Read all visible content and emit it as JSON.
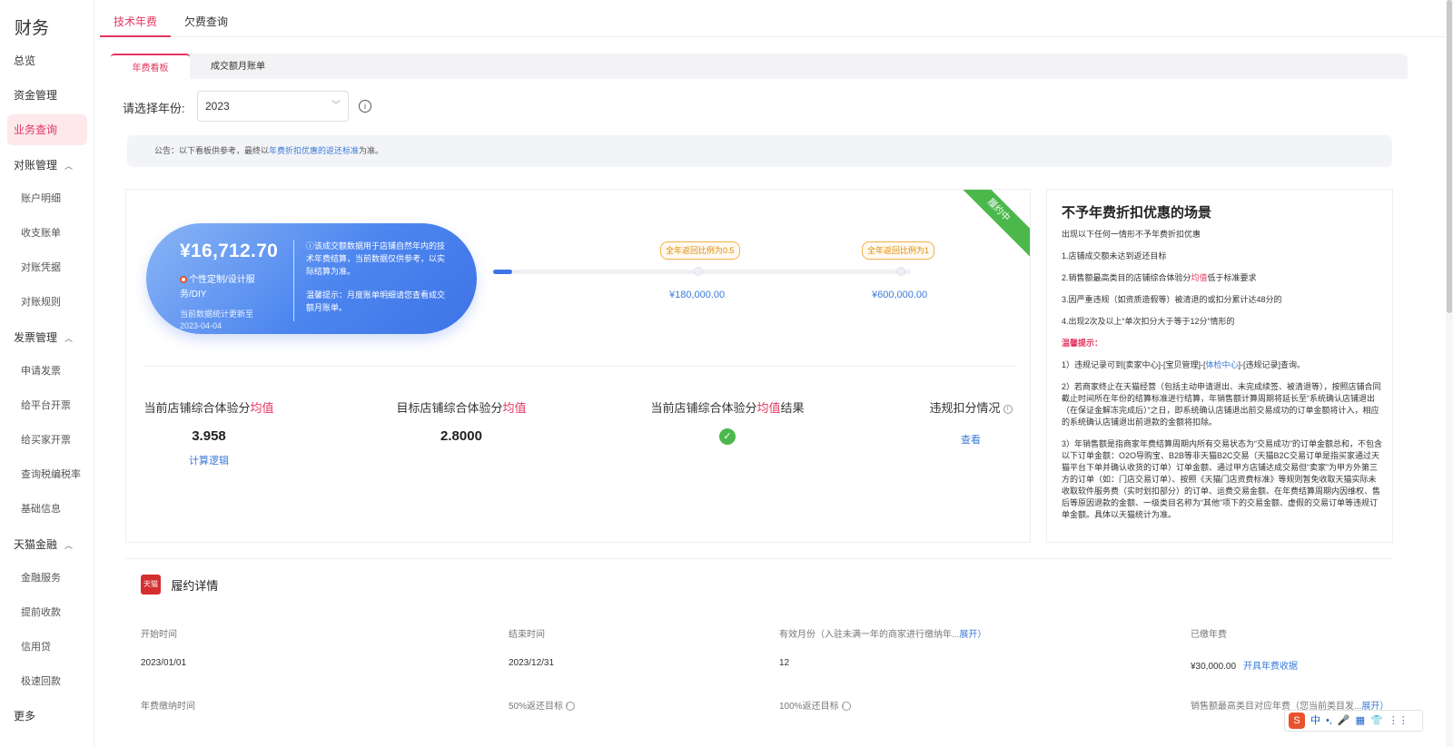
{
  "sidebar": {
    "brand": "财务",
    "items": [
      {
        "label": "总览"
      },
      {
        "label": "资金管理"
      },
      {
        "label": "业务查询"
      },
      {
        "label": "对账管理"
      },
      {
        "label": "账户明细"
      },
      {
        "label": "收支账单"
      },
      {
        "label": "对账凭据"
      },
      {
        "label": "对账规则"
      },
      {
        "label": "发票管理"
      },
      {
        "label": "申请发票"
      },
      {
        "label": "给平台开票"
      },
      {
        "label": "给买家开票"
      },
      {
        "label": "查询税编税率"
      },
      {
        "label": "基础信息"
      },
      {
        "label": "天猫金融"
      },
      {
        "label": "金融服务"
      },
      {
        "label": "提前收款"
      },
      {
        "label": "信用贷"
      },
      {
        "label": "极速回款"
      },
      {
        "label": "更多"
      }
    ]
  },
  "top_tabs": [
    {
      "label": "技术年费"
    },
    {
      "label": "欠费查询"
    }
  ],
  "inner_tabs": [
    {
      "label": "年费看板"
    },
    {
      "label": "成交额月账单"
    }
  ],
  "year": {
    "label": "请选择年份:",
    "value": "2023"
  },
  "notice": {
    "prefix": "公告：以下看板供参考，最终以",
    "link": "年费折扣优惠的返还标准",
    "suffix": "为准。"
  },
  "card": {
    "ribbon": "履约中",
    "amount": "¥16,712.70",
    "service": "个性定制/设计服务/DIY",
    "update": "当前数据统计更新至2023-04-04",
    "desc": "ⓘ该成交额数据用于店铺自然年内的技术年费结算，当前数据仅供参考，以实际结算为准。",
    "tip": "温馨提示：月度账单明细请您查看成交额月账单。",
    "milestones": [
      {
        "label": "全年返回比例为0.5",
        "amount": "¥180,000.00"
      },
      {
        "label": "全年返回比例为1",
        "amount": "¥600,000.00"
      }
    ],
    "progress": 0.045,
    "metrics": [
      {
        "label_prefix": "当前店铺综合体验分",
        "label_hl": "均值",
        "label_suffix": "",
        "value": "3.958",
        "link": "计算逻辑"
      },
      {
        "label_prefix": "目标店铺综合体验分",
        "label_hl": "均值",
        "label_suffix": "",
        "value": "2.8000"
      },
      {
        "label_prefix": "当前店铺综合体验分",
        "label_hl": "均值",
        "label_suffix": "结果",
        "value": "✓"
      },
      {
        "label_prefix": "违规扣分情况",
        "label_hl": "",
        "label_suffix": "",
        "link": "查看"
      }
    ]
  },
  "right_panel": {
    "title": "不予年费折扣优惠的场景",
    "intro": "出现以下任何一情形不予年费折扣优惠",
    "items": [
      "1.店铺成交额未达到返还目标",
      "2.销售额最高类目的店铺综合体验分",
      "3.因严重违规（如资质造假等）被清退的或扣分累计达48分的",
      "4.出现2次及以上“单次扣分大于等于12分”情形的"
    ],
    "item2_hl": "均值",
    "item2_suffix": "低于标准要求",
    "warn": "温馨提示：",
    "tip1_prefix": "1）违规记录可到[卖家中心]-[宝贝管理]-[",
    "tip1_link": "体检中心",
    "tip1_suffix": "]-[违规记录]查询。",
    "tip2": "2）若商家终止在天猫经营（包括主动申请退出、未完成续签、被清退等），按照店铺合同截止时间所在年份的结算标准进行结算，年销售额计算周期将延长至“系统确认店铺退出（在保证金解冻完成后）”之日，即系统确认店铺退出前交易成功的订单金额将计入，相应的系统确认店铺退出前退款的金额将扣除。",
    "tip3": "3）年销售额是指商家年费结算周期内所有交易状态为“交易成功”的订单金额总和，不包含以下订单金额：O2O导购宝、B2B等非天猫B2C交易（天猫B2C交易订单是指买家通过天猫平台下单并确认收货的订单）订单金额、通过甲方店铺达成交易但“卖家”为甲方外第三方的订单（如：门店交易订单）、按照《天猫门店资费标准》等规则暂免收取天猫实际未收取软件服务费（实时划扣部分）的订单、运费交易金额、在年费结算周期内因维权、售后等原因退款的金额、一级类目名称为“其他”项下的交易金额、虚假的交易订单等违规订单金额。具体以天猫统计为准。"
  },
  "details": {
    "tmall_logo": "天猫",
    "title": "履约详情",
    "headers": [
      "开始时间",
      "结束时间",
      "有效月份（入驻未满一年的商家进行缴纳年...",
      "已缴年费"
    ],
    "expand": "展开）",
    "values": [
      "2023/01/01",
      "2023/12/31",
      "12",
      "¥30,000.00"
    ],
    "receipt_link": "开具年费收据",
    "headers2": [
      "年费缴纳时间",
      "50%返还目标",
      "100%返还目标",
      "销售额最高类目对应年费（您当前类目发..."
    ],
    "expand2": "展开）"
  },
  "ime": {
    "items": [
      "中",
      "•,",
      "🎤",
      "▦",
      "👕",
      "⋮⋮"
    ]
  }
}
